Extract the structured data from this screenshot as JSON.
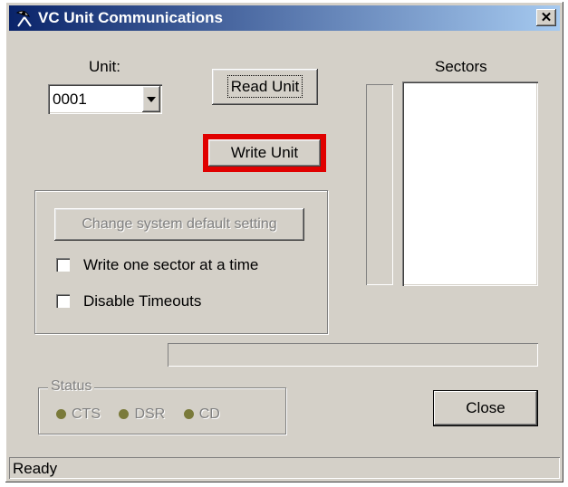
{
  "window": {
    "title": "VC Unit Communications",
    "close_glyph": "✕"
  },
  "unit": {
    "label": "Unit:",
    "value": "0001"
  },
  "buttons": {
    "read_unit": "Read Unit",
    "write_unit": "Write Unit",
    "change_default": "Change system default setting",
    "close": "Close"
  },
  "options": {
    "write_one_sector": "Write one sector at a time",
    "disable_timeouts": "Disable Timeouts"
  },
  "sectors": {
    "label": "Sectors"
  },
  "status": {
    "group_label": "Status",
    "indicators": [
      "CTS",
      "DSR",
      "CD"
    ]
  },
  "statusbar": {
    "text": "Ready"
  },
  "colors": {
    "highlight": "#e00000",
    "title_start": "#0a246a",
    "title_end": "#a6caf0"
  },
  "icons": {
    "app": "satellite-dish-icon",
    "dropdown": "chevron-down-icon"
  }
}
